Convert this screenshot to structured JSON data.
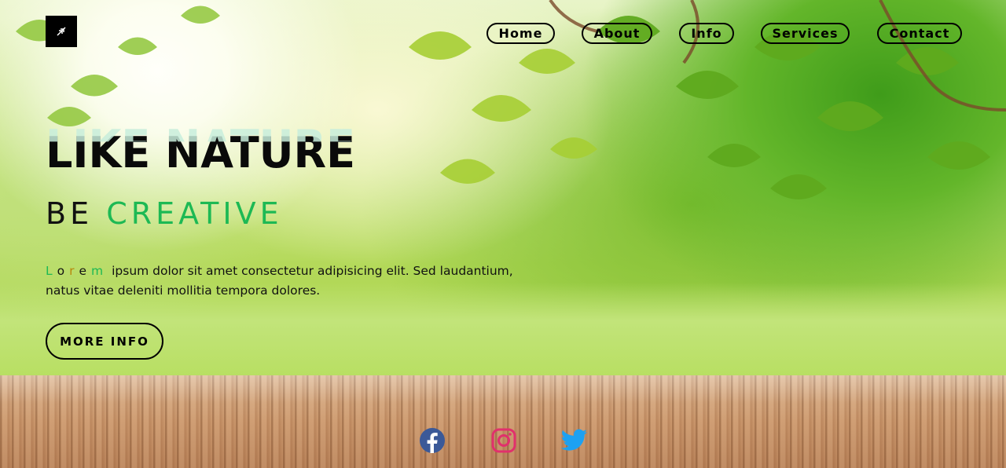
{
  "header": {
    "logo_icon": "leaf-logo-icon",
    "nav": [
      {
        "label": "Home"
      },
      {
        "label": "About"
      },
      {
        "label": "Info"
      },
      {
        "label": "Services"
      },
      {
        "label": "Contact"
      }
    ]
  },
  "hero": {
    "title": "LIKE NATURE",
    "subtitle_prefix": "BE",
    "subtitle_accent": "CREATIVE",
    "description_lead": [
      "L",
      "o",
      "r",
      "e",
      "m"
    ],
    "description_rest": "ipsum dolor sit amet consectetur adipisicing elit. Sed laudantium, natus vitae deleniti mollitia tempora dolores.",
    "button_label": "MORE INFO"
  },
  "socials": [
    {
      "icon": "facebook-icon",
      "color": "#3b5998"
    },
    {
      "icon": "instagram-icon",
      "color": "#e1306c"
    },
    {
      "icon": "twitter-icon",
      "color": "#1da1f2"
    }
  ],
  "colors": {
    "accent_green": "#1db954",
    "title_ghost": "#c8eedc",
    "lead_letters": [
      "#1db954",
      "#111111",
      "#b8860b",
      "#111111",
      "#1db954"
    ]
  }
}
